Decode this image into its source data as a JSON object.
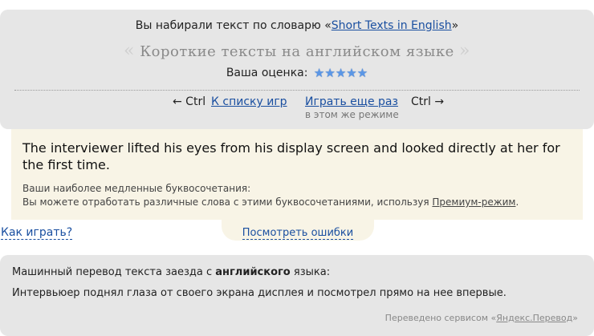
{
  "header": {
    "prefix": "Вы набирали текст по словарю «",
    "vocab_link": "Short Texts in English",
    "suffix": "»",
    "title": "Короткие тексты на английском языке",
    "quote_open": "«",
    "quote_close": "»",
    "rating_label": "Ваша оценка:",
    "stars": [
      "★",
      "★",
      "★",
      "★",
      "★"
    ]
  },
  "nav": {
    "back_arrow": "← Ctrl",
    "games_list": "К списку игр",
    "play_again": "Играть еще раз",
    "forward": "Ctrl →",
    "same_mode": "в этом же режиме"
  },
  "result": {
    "typed_text": "The interviewer lifted his eyes from his display screen and looked directly at her for the first time.",
    "slow_combos_label": "Ваши наиболее медленные буквосочетания:",
    "practice_prefix": "Вы можете отработать различные слова с этими буквосочетаниями, используя ",
    "premium_link": "Премиум-режим",
    "practice_suffix": "."
  },
  "view_errors": "Посмотреть ошибки",
  "how_to_play": "Как играть?",
  "translation": {
    "title_prefix": "Машинный перевод текста заезда с ",
    "language": "английского",
    "title_suffix": " языка:",
    "text": "Интервьюер поднял глаза от своего экрана дисплея и посмотрел прямо на нее впервые.",
    "credit_prefix": "Переведено сервисом «",
    "credit_link": "Яндекс.Перевод",
    "credit_suffix": "»"
  },
  "colors": {
    "panel": "#e6e6e6",
    "text_box": "#f8f4e6",
    "link": "#1a4fa0",
    "star": "#5b97e6"
  }
}
